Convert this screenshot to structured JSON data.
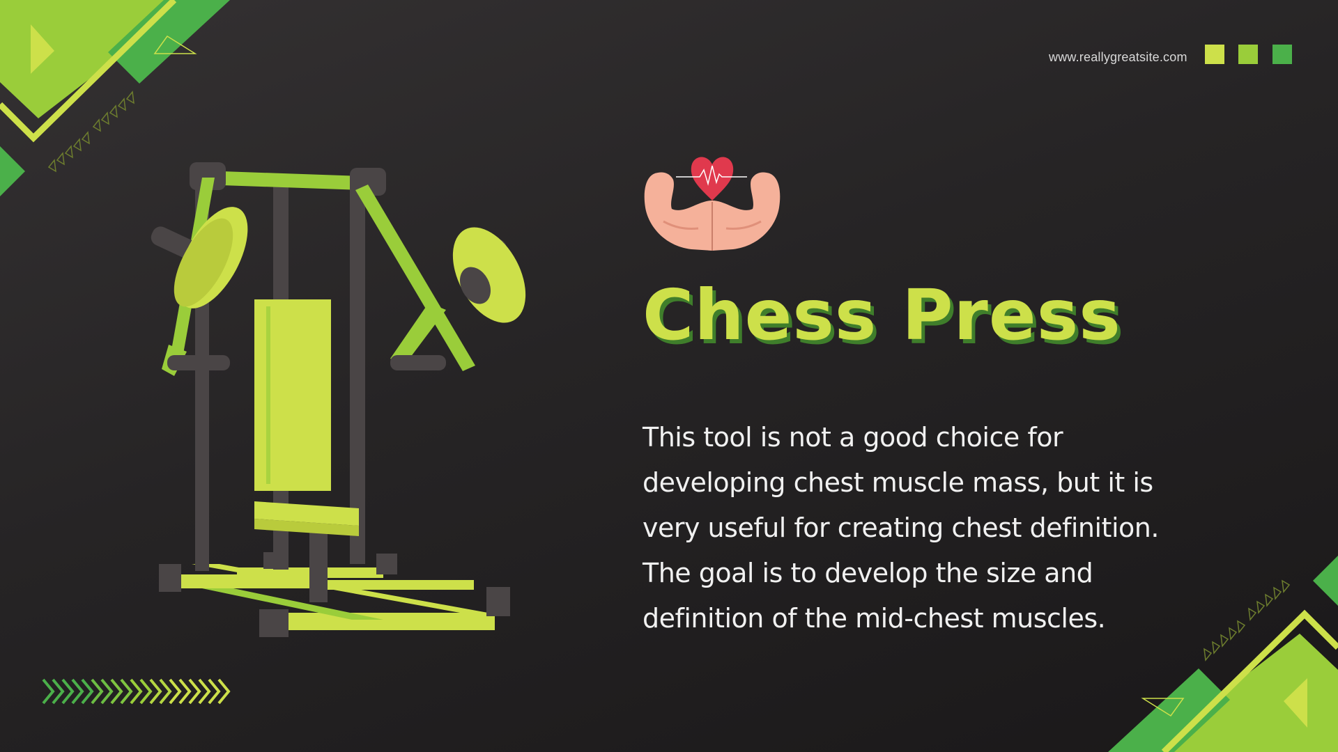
{
  "header": {
    "website": "www.reallygreatsite.com"
  },
  "slide": {
    "title": "Chess Press",
    "description": "This tool is not a good choice for developing chest muscle mass, but it is very useful for creating chest definition. The goal is to develop the size and definition of the mid-chest muscles."
  },
  "colors": {
    "background": "#282627",
    "lime": "#cde04a",
    "light_green": "#9acd3a",
    "green": "#4bb04a",
    "title_shadow": "#3f7e2b",
    "machine_frame": "#4a4546",
    "heart": "#e0394d",
    "arms": "#f5b19a"
  },
  "icons": {
    "muscle_icon": "flexed-arms-heart-icon",
    "machine": "chest-press-machine-illustration"
  }
}
